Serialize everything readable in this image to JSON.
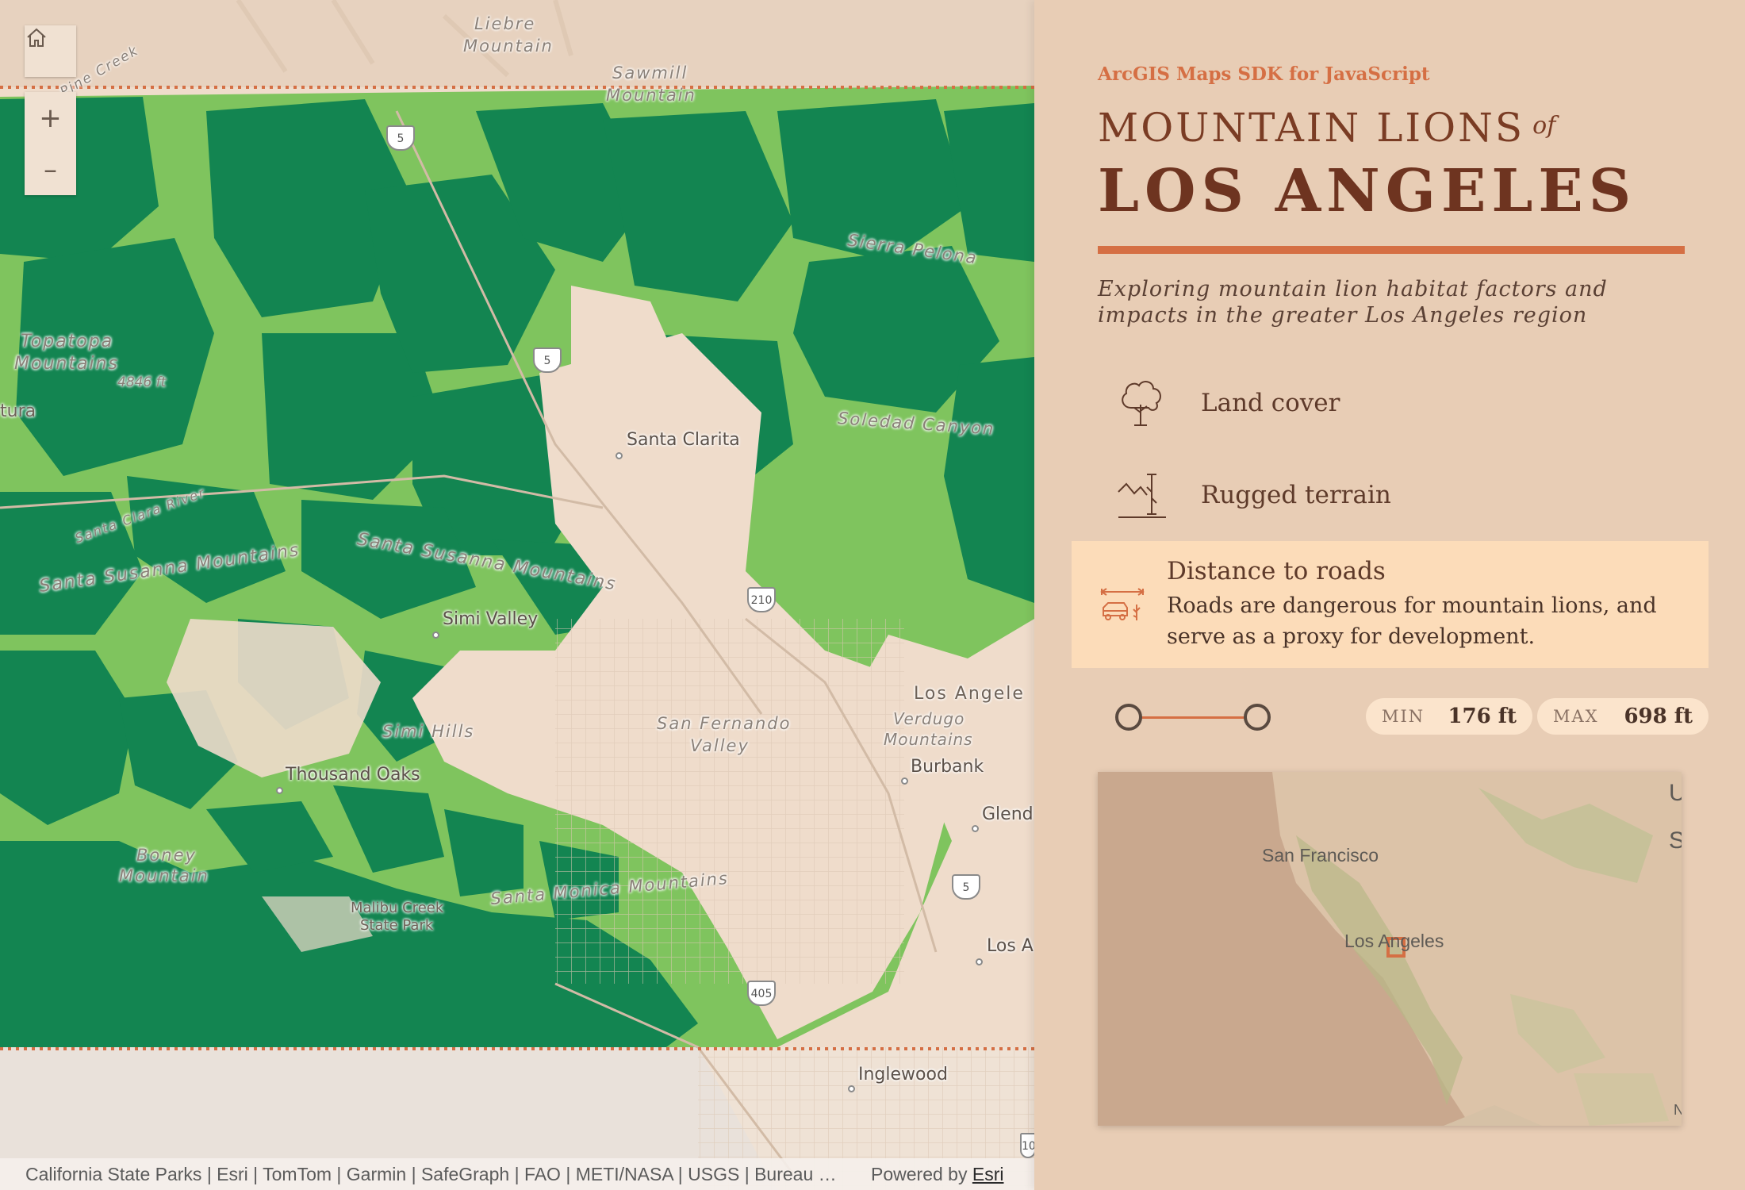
{
  "map": {
    "labels": {
      "liebre": "Liebre\nMountain",
      "liebre_1": "Liebre",
      "liebre_2": "Mountain",
      "sawmill_1": "Sawmill",
      "sawmill_2": "Mountain",
      "pine_creek": "Pine Creek",
      "sierra_pelona": "Sierra Pelona",
      "topatopa_1": "Topatopa",
      "topatopa_2": "Mountains",
      "elev": "4846 ft",
      "tura": "tura",
      "santa_clarita": "Santa Clarita",
      "soledad": "Soledad Canyon",
      "santa_clara_river": "Santa Clara River",
      "ssm_1": "Santa Susanna Mountains",
      "ssm_2": "Santa Susanna Mountains",
      "simi_valley": "Simi Valley",
      "los_angeles_edge": "Los Angele",
      "verdugo_1": "Verdugo",
      "verdugo_2": "Mountains",
      "burbank": "Burbank",
      "sfv_1": "San Fernando",
      "sfv_2": "Valley",
      "simi_hills": "Simi Hills",
      "thousand_oaks": "Thousand Oaks",
      "glendale_edge": "Glend",
      "boney_1": "Boney",
      "boney_2": "Mountain",
      "malibu_1": "Malibu Creek",
      "malibu_2": "State Park",
      "santa_monica_mtns": "Santa Monica Mountains",
      "los_a_edge": "Los A",
      "inglewood": "Inglewood"
    },
    "shields": {
      "i5_top": "5",
      "i5_mid": "5",
      "i210": "210",
      "i5_low": "5",
      "i405": "405",
      "i10_edge": "10"
    },
    "colors": {
      "habitat": "#138551",
      "buffer": "#7fc45e",
      "land": "#efdccb",
      "boundary": "#d56f44"
    }
  },
  "controls": {
    "home": "home-icon",
    "zoom_in": "+",
    "zoom_out": "–"
  },
  "attribution": {
    "text": "California State Parks | Esri | TomTom | Garmin | SafeGraph | FAO | METI/NASA | USGS | Bureau …",
    "powered": "Powered by",
    "esri": "Esri"
  },
  "panel": {
    "sdk": "ArcGIS Maps SDK for JavaScript",
    "title_line1": "MOUNTAIN LIONS",
    "title_of": "of",
    "title_line2": "LOS ANGELES",
    "subtitle": "Exploring mountain lion habitat factors and impacts in the greater Los Angeles region",
    "factors": [
      {
        "label": "Land cover",
        "icon": "tree-icon"
      },
      {
        "label": "Rugged terrain",
        "icon": "terrain-icon"
      },
      {
        "label": "Distance to roads",
        "icon": "car-distance-icon",
        "description": "Roads are dangerous for mountain lions, and serve as a proxy for development."
      }
    ],
    "range": {
      "min_label": "MIN",
      "min_value": "176 ft",
      "max_label": "MAX",
      "max_value": "698 ft"
    },
    "overview": {
      "sf": "San Francisco",
      "la": "Los Angeles",
      "u": "U",
      "s": "S",
      "n": "N"
    },
    "colors": {
      "accent": "#d56f44",
      "title": "#6e3420",
      "active_bg": "#fcdcb9"
    }
  }
}
